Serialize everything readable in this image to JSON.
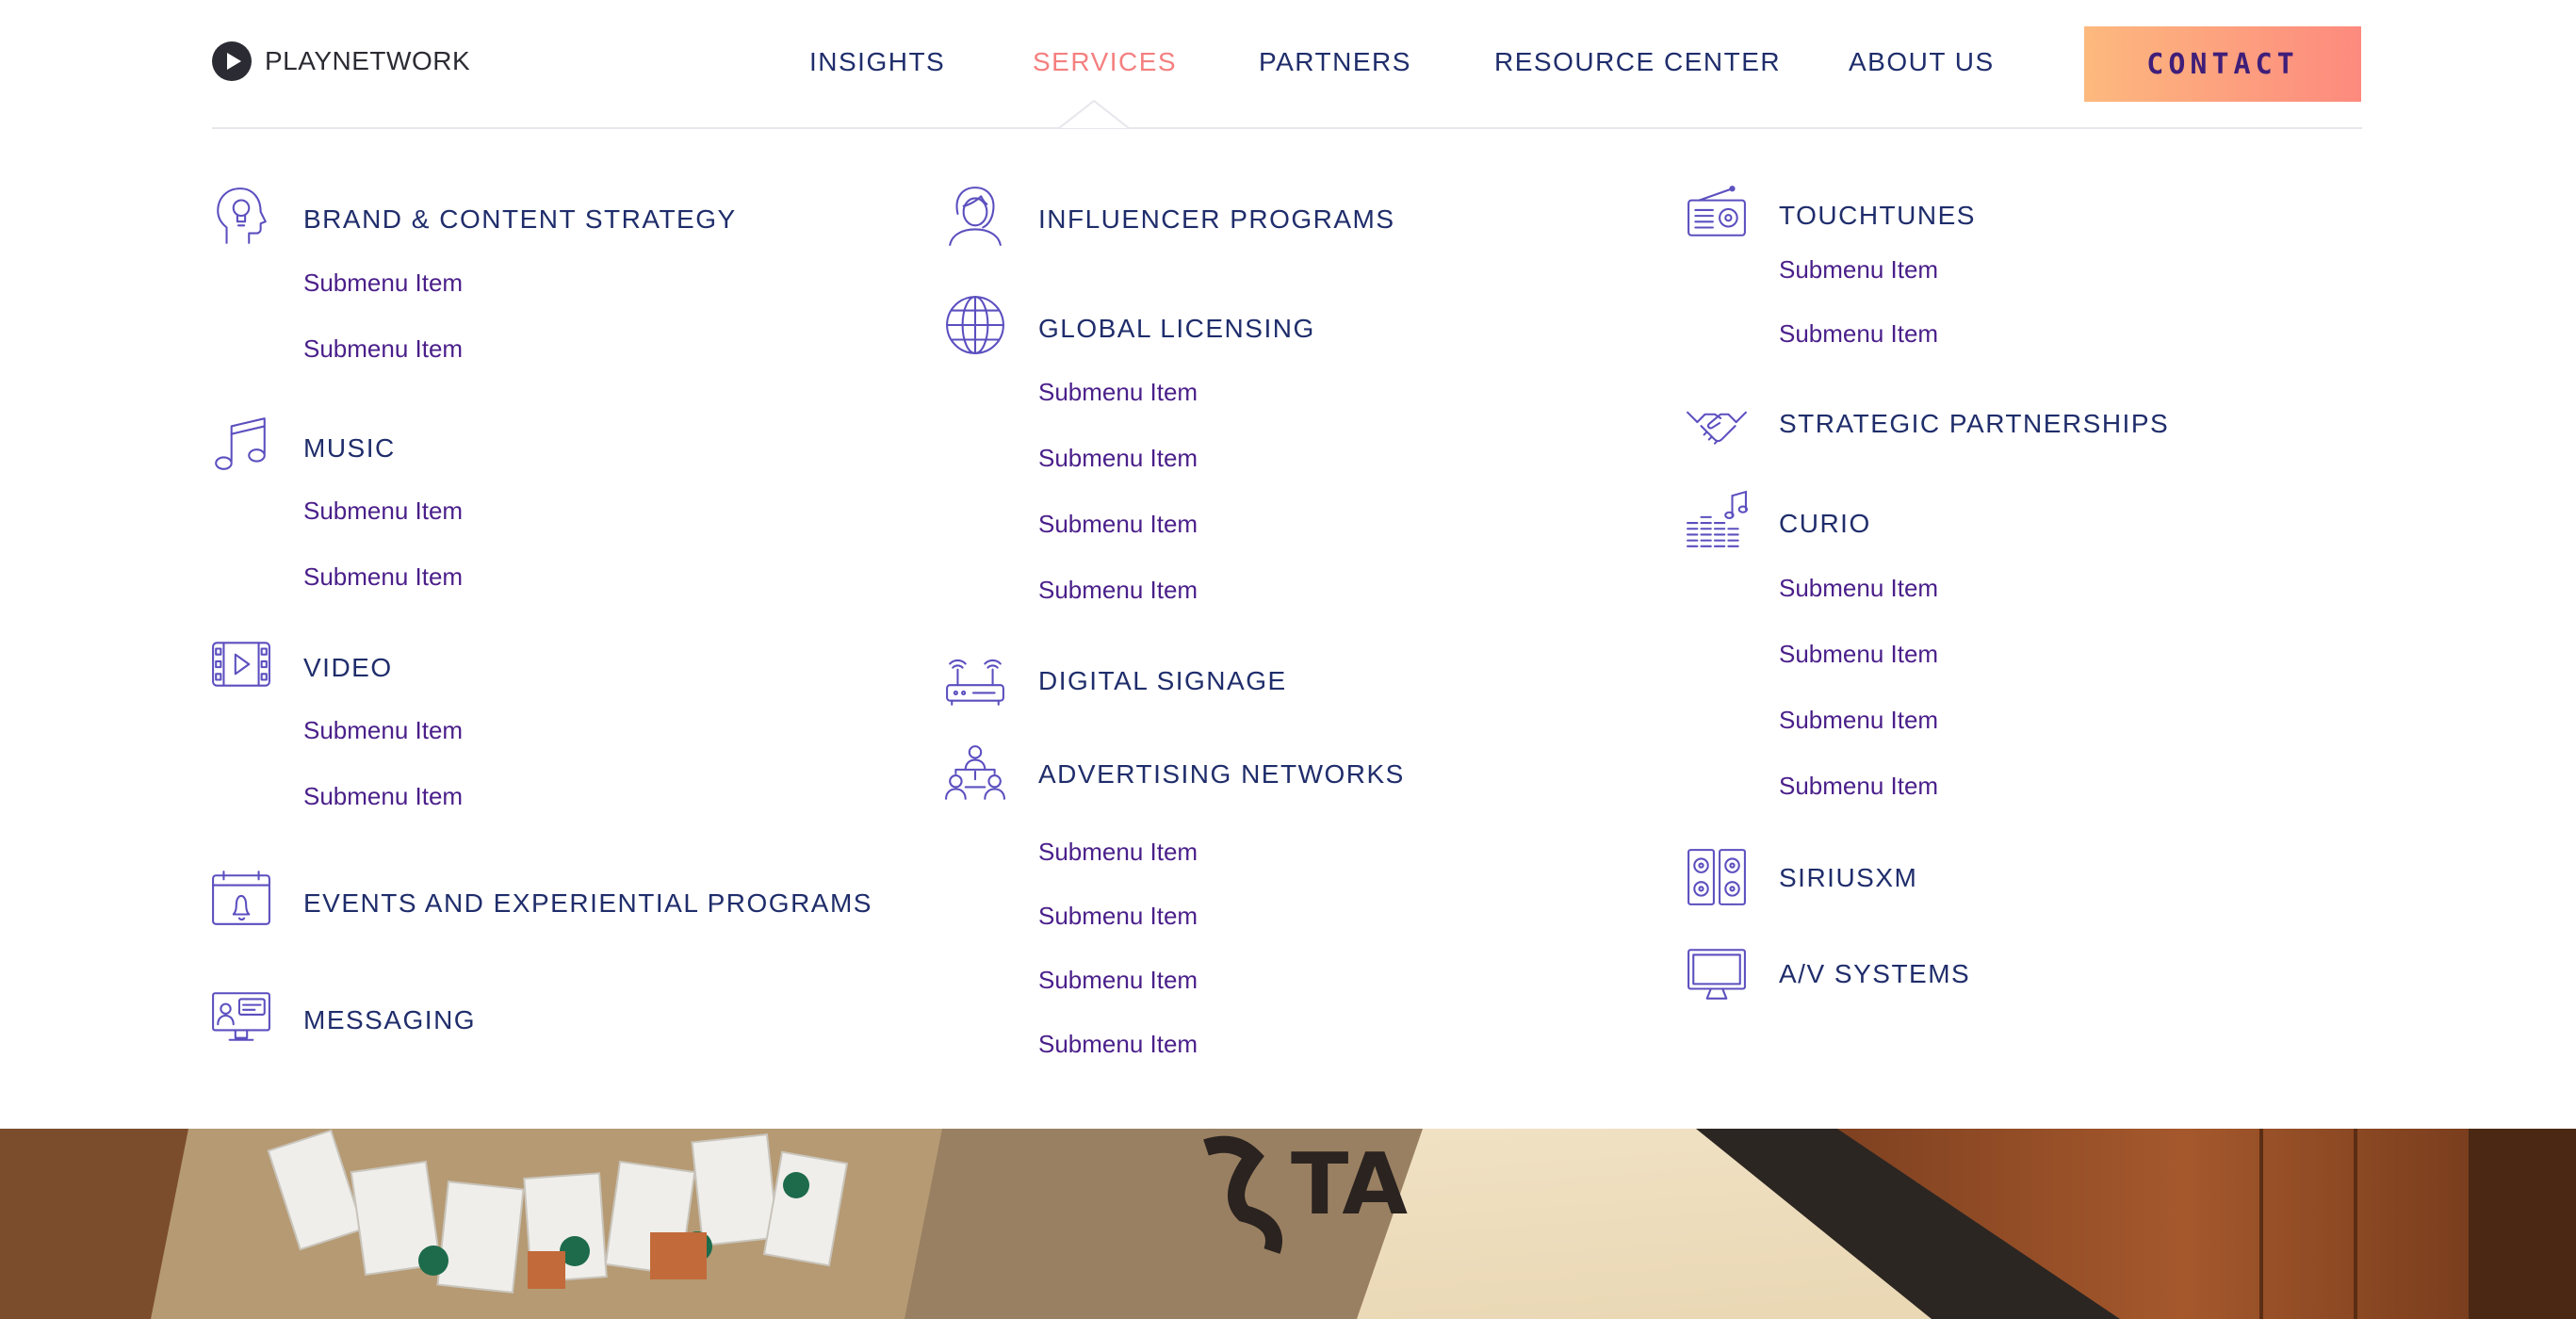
{
  "brand": {
    "name": "PLAYNETWORK"
  },
  "nav": {
    "items": [
      {
        "label": "INSIGHTS"
      },
      {
        "label": "SERVICES"
      },
      {
        "label": "PARTNERS"
      },
      {
        "label": "RESOURCE CENTER"
      },
      {
        "label": "ABOUT US"
      }
    ],
    "active": "SERVICES",
    "contact_label": "CONTACT"
  },
  "menu": {
    "brand_content": {
      "title": "BRAND & CONTENT STRATEGY",
      "icon": "lightbulb-head-icon",
      "items": [
        "Submenu Item",
        "Submenu Item"
      ]
    },
    "music": {
      "title": "MUSIC",
      "icon": "music-note-icon",
      "items": [
        "Submenu Item",
        "Submenu Item"
      ]
    },
    "video": {
      "title": "VIDEO",
      "icon": "video-film-icon",
      "items": [
        "Submenu Item",
        "Submenu Item"
      ]
    },
    "events": {
      "title": "EVENTS AND EXPERIENTIAL PROGRAMS",
      "icon": "calendar-bell-icon"
    },
    "messaging": {
      "title": "MESSAGING",
      "icon": "monitor-chat-icon"
    },
    "influencer": {
      "title": "INFLUENCER PROGRAMS",
      "icon": "person-avatar-icon"
    },
    "global_licensing": {
      "title": "GLOBAL LICENSING",
      "icon": "globe-icon",
      "items": [
        "Submenu Item",
        "Submenu Item",
        "Submenu Item",
        "Submenu Item"
      ]
    },
    "digital_signage": {
      "title": "DIGITAL SIGNAGE",
      "icon": "router-icon"
    },
    "advertising": {
      "title": "ADVERTISING NETWORKS",
      "icon": "people-network-icon",
      "items": [
        "Submenu Item",
        "Submenu Item",
        "Submenu Item",
        "Submenu Item"
      ]
    },
    "touchtunes": {
      "title": "TOUCHTUNES",
      "icon": "radio-icon",
      "items": [
        "Submenu Item",
        "Submenu Item"
      ]
    },
    "strategic": {
      "title": "STRATEGIC PARTNERSHIPS",
      "icon": "handshake-icon"
    },
    "curio": {
      "title": "CURIO",
      "icon": "equalizer-music-icon",
      "items": [
        "Submenu Item",
        "Submenu Item",
        "Submenu Item",
        "Submenu Item"
      ]
    },
    "siriusxm": {
      "title": "SIRIUSXM",
      "icon": "speakers-icon"
    },
    "av_systems": {
      "title": "A/V SYSTEMS",
      "icon": "monitor-icon"
    }
  },
  "colors": {
    "nav_text": "#1f2d6b",
    "nav_active": "#f57f7f",
    "submenu_text": "#4a1f8a",
    "icon_stroke": "#5b4fbf",
    "contact_gradient": [
      "#fdb97e",
      "#fd8a7e"
    ],
    "contact_text": "#3f1e79"
  }
}
